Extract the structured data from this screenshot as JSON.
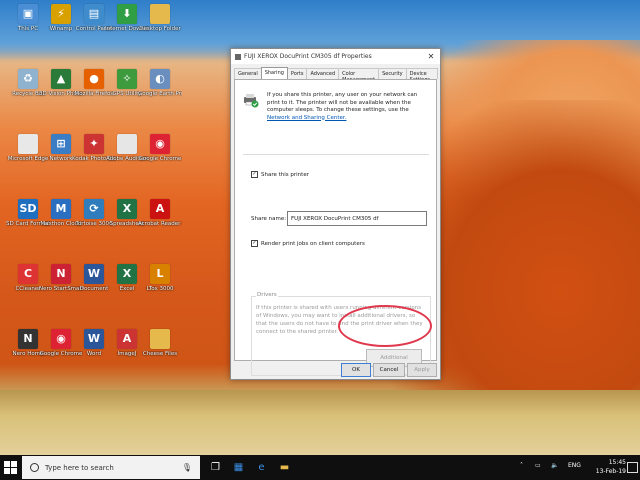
{
  "desktop": {
    "icons": [
      {
        "label": "This PC",
        "icon": "computer-icon",
        "color": "#4a8fd6",
        "glyph": "▣"
      },
      {
        "label": "Recycle Bin",
        "icon": "recycle-bin-icon",
        "color": "#8fb2cf",
        "glyph": "♻"
      },
      {
        "label": "Microsoft Edge",
        "icon": "document-icon",
        "color": "#e8e8e8",
        "glyph": ""
      },
      {
        "label": "SD Card Formatter",
        "icon": "sd-card-icon",
        "color": "#1f6fc0",
        "glyph": "SD"
      },
      {
        "label": "CCleaner",
        "icon": "ccleaner-icon",
        "color": "#d33",
        "glyph": "C"
      },
      {
        "label": "Nero Home",
        "icon": "nero-icon",
        "color": "#333",
        "glyph": "N"
      },
      {
        "label": "Winamp",
        "icon": "winamp-icon",
        "color": "#d8a000",
        "glyph": "⚡"
      },
      {
        "label": "3D Vision Photo Viewer",
        "icon": "photo-viewer-icon",
        "color": "#2a7a3a",
        "glyph": "▲"
      },
      {
        "label": "Network",
        "icon": "network-icon",
        "color": "#3b7dc4",
        "glyph": "⊞"
      },
      {
        "label": "Maxthon Cloud",
        "icon": "maxthon-icon",
        "color": "#2a6fc0",
        "glyph": "M"
      },
      {
        "label": "Nero StartSmart",
        "icon": "nero-smart-icon",
        "color": "#c23",
        "glyph": "N"
      },
      {
        "label": "Google Chrome",
        "icon": "chrome-icon",
        "color": "#d23",
        "glyph": "◉"
      },
      {
        "label": "Control Panel",
        "icon": "control-panel-icon",
        "color": "#3f8ccd",
        "glyph": "▤"
      },
      {
        "label": "Mozilla Firefox",
        "icon": "firefox-icon",
        "color": "#e66000",
        "glyph": "●"
      },
      {
        "label": "Kodak Photo Studio",
        "icon": "photo-studio-icon",
        "color": "#c33",
        "glyph": "✦"
      },
      {
        "label": "Tortoise 3000",
        "icon": "tortoise-icon",
        "color": "#2f7dbd",
        "glyph": "⟳"
      },
      {
        "label": "Document",
        "icon": "word-doc-icon",
        "color": "#2b579a",
        "glyph": "W"
      },
      {
        "label": "Word",
        "icon": "word-icon",
        "color": "#2b579a",
        "glyph": "W"
      },
      {
        "label": "Internet Download",
        "icon": "idm-icon",
        "color": "#2f9e44",
        "glyph": "⬇"
      },
      {
        "label": "GPS Utility",
        "icon": "gps-icon",
        "color": "#3d9a3d",
        "glyph": "✧"
      },
      {
        "label": "Adobe Audition",
        "icon": "audition-icon",
        "color": "#e6e6e6",
        "glyph": ""
      },
      {
        "label": "Spreadsheet",
        "icon": "excel-doc-icon",
        "color": "#217346",
        "glyph": "X"
      },
      {
        "label": "Excel",
        "icon": "excel-icon",
        "color": "#217346",
        "glyph": "X"
      },
      {
        "label": "ImageJ",
        "icon": "imagej-icon",
        "color": "#c33",
        "glyph": "A"
      },
      {
        "label": "Desktop Folder",
        "icon": "folder-icon",
        "color": "#e6b94c",
        "glyph": ""
      },
      {
        "label": "Google Earth Pro",
        "icon": "google-earth-icon",
        "color": "#6a8fbf",
        "glyph": "◐"
      },
      {
        "label": "Google Chrome",
        "icon": "chrome-icon",
        "color": "#d23",
        "glyph": "◉"
      },
      {
        "label": "Acrobat Reader DC",
        "icon": "acrobat-icon",
        "color": "#c11",
        "glyph": "A"
      },
      {
        "label": "LTox 3000",
        "icon": "ltox-icon",
        "color": "#d88000",
        "glyph": "L"
      },
      {
        "label": "Cheese Files",
        "icon": "folder-icon",
        "color": "#e6b94c",
        "glyph": ""
      }
    ]
  },
  "dialog": {
    "title": "FUJI XEROX DocuPrint CM305 df Properties",
    "tabs": [
      "General",
      "Sharing",
      "Ports",
      "Advanced",
      "Color Management",
      "Security",
      "Device Settings"
    ],
    "active_tab": "Sharing",
    "info_text": "If you share this printer, any user on your network can print to it. The printer will not be available when the computer sleeps. To change these settings, use the",
    "info_link": "Network and Sharing Center.",
    "share_checkbox_label": "Share this printer",
    "share_checked": true,
    "share_name_label": "Share name:",
    "share_name_value": "FUJI XEROX DocuPrint CM305 df",
    "render_checkbox_label": "Render print jobs on client computers",
    "render_checked": true,
    "drivers_legend": "Drivers",
    "drivers_text": "If this printer is shared with users running different versions of Windows, you may want to install additional drivers, so that the users do not have to find the print driver when they connect to the shared printer.",
    "additional_drivers_label": "Additional Drivers...",
    "ok_label": "OK",
    "cancel_label": "Cancel",
    "apply_label": "Apply",
    "close_glyph": "✕"
  },
  "taskbar": {
    "search_placeholder": "Type here to search",
    "language": "ENG",
    "time": "15:45",
    "date": "13-Feb-19",
    "start_color": "#ffffff"
  }
}
